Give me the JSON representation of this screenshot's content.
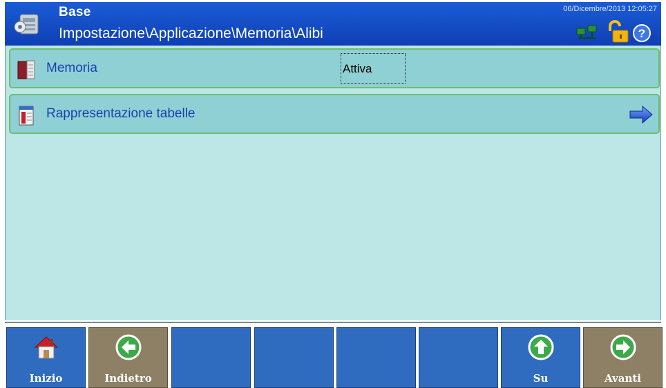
{
  "header": {
    "title": "Base",
    "path": "Impostazione\\Applicazione\\Memoria\\Alibi",
    "datetime": "06/Dicembre/2013 12:05:27",
    "icons": [
      "network-icon",
      "unlock-icon",
      "help-icon"
    ]
  },
  "rows": [
    {
      "label": "Memoria",
      "value": "Attiva",
      "icon": "book-icon"
    },
    {
      "label": "Rappresentazione tabelle",
      "icon": "table-icon",
      "action_icon": "arrow-right-icon"
    }
  ],
  "softkeys": [
    {
      "label": "Inizio",
      "icon": "home-icon",
      "color": "#2f6cc0"
    },
    {
      "label": "Indietro",
      "icon": "arrow-left-icon",
      "color": "#8e8065"
    },
    {
      "label": "",
      "color": "#2f6cc0"
    },
    {
      "label": "",
      "color": "#2f6cc0"
    },
    {
      "label": "",
      "color": "#2f6cc0"
    },
    {
      "label": "",
      "color": "#2f6cc0"
    },
    {
      "label": "Su",
      "icon": "arrow-up-icon",
      "color": "#2f6cc0"
    },
    {
      "label": "Avanti",
      "icon": "arrow-right-icon",
      "color": "#8e8065"
    }
  ],
  "colors": {
    "header_bg": "#1b5cd6",
    "content_bg": "#bde7e6",
    "row_bg": "#8fd0d5",
    "row_border": "#6bbf6e",
    "softkey_blue": "#2f6cc0",
    "softkey_tan": "#8e8065"
  }
}
